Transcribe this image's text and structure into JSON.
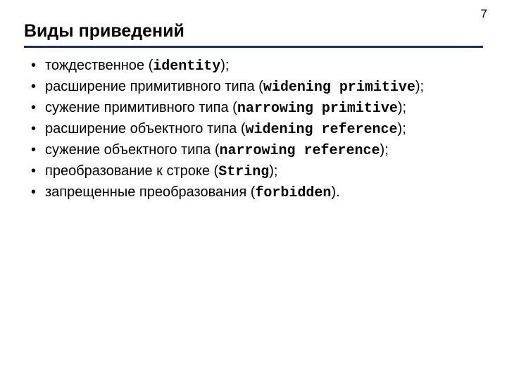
{
  "page_number": "7",
  "title": "Виды приведений",
  "items": [
    {
      "pre": "тождественное (",
      "term": "identity",
      "post": ");"
    },
    {
      "pre": "расширение примитивного типа (",
      "term": "widening primitive",
      "post": ");"
    },
    {
      "pre": "сужение примитивного типа (",
      "term": "narrowing primitive",
      "post": ");"
    },
    {
      "pre": "расширение объектного типа (",
      "term": "widening reference",
      "post": ");"
    },
    {
      "pre": "сужение объектного типа (",
      "term": "narrowing reference",
      "post": ");"
    },
    {
      "pre": "преобразование к строке (",
      "term": "String",
      "post": ");"
    },
    {
      "pre": "запрещенные преобразования (",
      "term": "forbidden",
      "post": ")."
    }
  ]
}
